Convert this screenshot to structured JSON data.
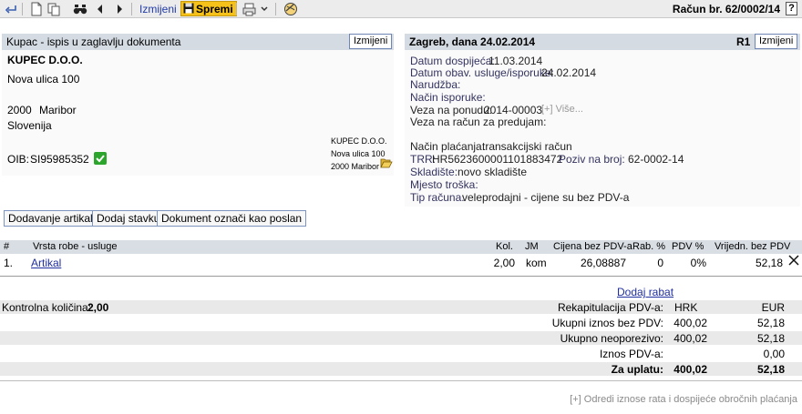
{
  "toolbar": {
    "edit_label": "Izmijeni",
    "save_label": "Spremi",
    "document_title": "Račun br. 62/0002/14",
    "help_label": "?"
  },
  "buyer_panel": {
    "header": "Kupac - ispis u zaglavlju dokumenta",
    "edit_button": "Izmijeni",
    "name": "KUPEC D.O.O.",
    "street": "Nova ulica 100",
    "postal_code": "2000",
    "city": "Maribor",
    "country": "Slovenija",
    "oib_label": "OIB:",
    "oib_value": "SI95985352",
    "small_address": {
      "line1": "KUPEC D.O.O.",
      "line2": "Nova ulica 100",
      "line3": "2000 Maribor"
    }
  },
  "invoice_panel": {
    "header": "Zagreb, dana 24.02.2014",
    "code": "R1",
    "edit_button": "Izmijeni",
    "due_date_label": "Datum dospijeća:",
    "due_date": "11.03.2014",
    "delivery_date_label": "Datum obav. usluge/isporuke:",
    "delivery_date": "24.02.2014",
    "order_label": "Narudžba:",
    "delivery_method_label": "Način isporuke:",
    "offer_link_label": "Veza na ponudu:",
    "offer_link_value": "2014-00003",
    "offer_more": "[+] Više...",
    "prepayment_label": "Veza na račun za predujam:",
    "payment_method_label": "Način plaćanja:",
    "payment_method": "transakcijski račun",
    "trr_label": "TRR:",
    "trr_value": "HR5623600001101883472",
    "reference_label": "Poziv na broj:",
    "reference_value": "62-0002-14",
    "warehouse_label": "Skladište:",
    "warehouse_value": "novo skladište",
    "cost_place_label": "Mjesto troška:",
    "invoice_type_label": "Tip računa:",
    "invoice_type_value": "veleprodajni - cijene su bez PDV-a"
  },
  "actions": {
    "add_articles": "Dodavanje artikala",
    "add_item": "Dodaj stavku",
    "mark_sent": "Dokument označi kao poslan"
  },
  "items_table": {
    "headers": {
      "num": "#",
      "item": "Vrsta robe - usluge",
      "qty": "Kol.",
      "unit": "JM",
      "price": "Cijena bez PDV-a",
      "discount": "Rab. %",
      "vat": "PDV %",
      "value": "Vrijedn. bez PDV"
    },
    "rows": [
      {
        "num": "1.",
        "item": "Artikal",
        "qty": "2,00",
        "unit": "kom",
        "price": "26,08887",
        "discount": "0",
        "vat": "0%",
        "value": "52,18"
      }
    ]
  },
  "totals": {
    "add_discount": "Dodaj rabat",
    "control_qty_label": "Kontrolna količina:",
    "control_qty_value": "2,00",
    "vat_recap_label": "Rekapitulacija PDV-a:",
    "currency1": "HRK",
    "currency2": "EUR",
    "net_label": "Ukupni iznos bez PDV:",
    "net_hrk": "400,02",
    "net_eur": "52,18",
    "untaxed_label": "Ukupno neoporezivo:",
    "untaxed_hrk": "400,02",
    "untaxed_eur": "52,18",
    "vat_label": "Iznos PDV-a:",
    "vat_eur": "0,00",
    "total_label": "Za uplatu:",
    "total_hrk": "400,02",
    "total_eur": "52,18"
  },
  "footer": {
    "installments_link": "[+] Odredi iznose rata i dospijeće obročnih plaćanja"
  },
  "colors": {
    "save_button": "#f6c21a",
    "panel_header": "#d4dbe3",
    "link": "#1f2e9e",
    "check_green": "#2ca52c"
  }
}
